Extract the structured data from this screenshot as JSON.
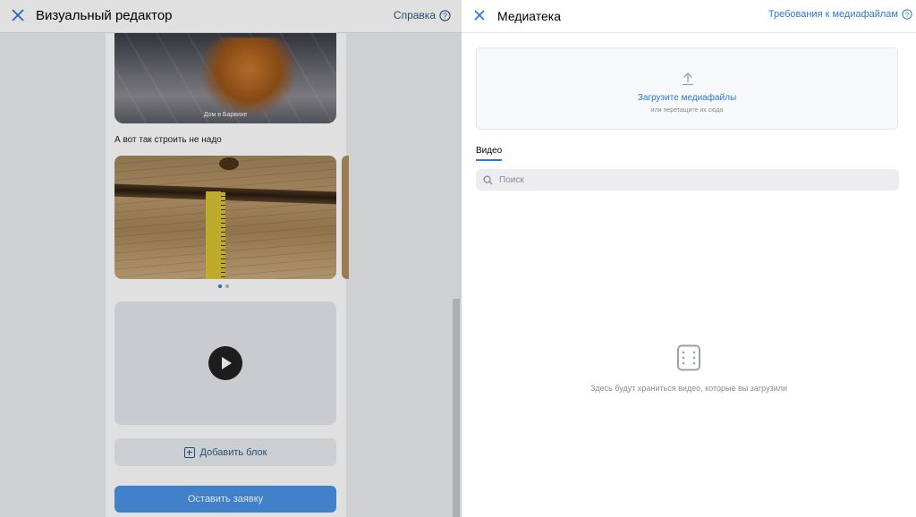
{
  "editor": {
    "title": "Визуальный редактор",
    "help_label": "Справка",
    "photo_caption": "Дом в Барвихе",
    "text_block": "А вот так строить не надо",
    "carousel": {
      "slides": 2,
      "active_index": 0
    },
    "add_block_label": "Добавить блок",
    "submit_label": "Оставить заявку"
  },
  "media": {
    "title": "Медиатека",
    "requirements_label": "Требования к медиафайлам",
    "upload": {
      "label": "Загрузите медиафайлы",
      "hint": "или перетащите их сюда"
    },
    "tabs": [
      {
        "label": "Видео",
        "active": true
      }
    ],
    "search": {
      "placeholder": "Поиск",
      "value": ""
    },
    "empty_text": "Здесь будут храниться видео, которые вы загрузили"
  },
  "colors": {
    "accent": "#2a78d6",
    "link": "#2a5885",
    "muted": "#818c99",
    "button": "#4a93e5"
  }
}
